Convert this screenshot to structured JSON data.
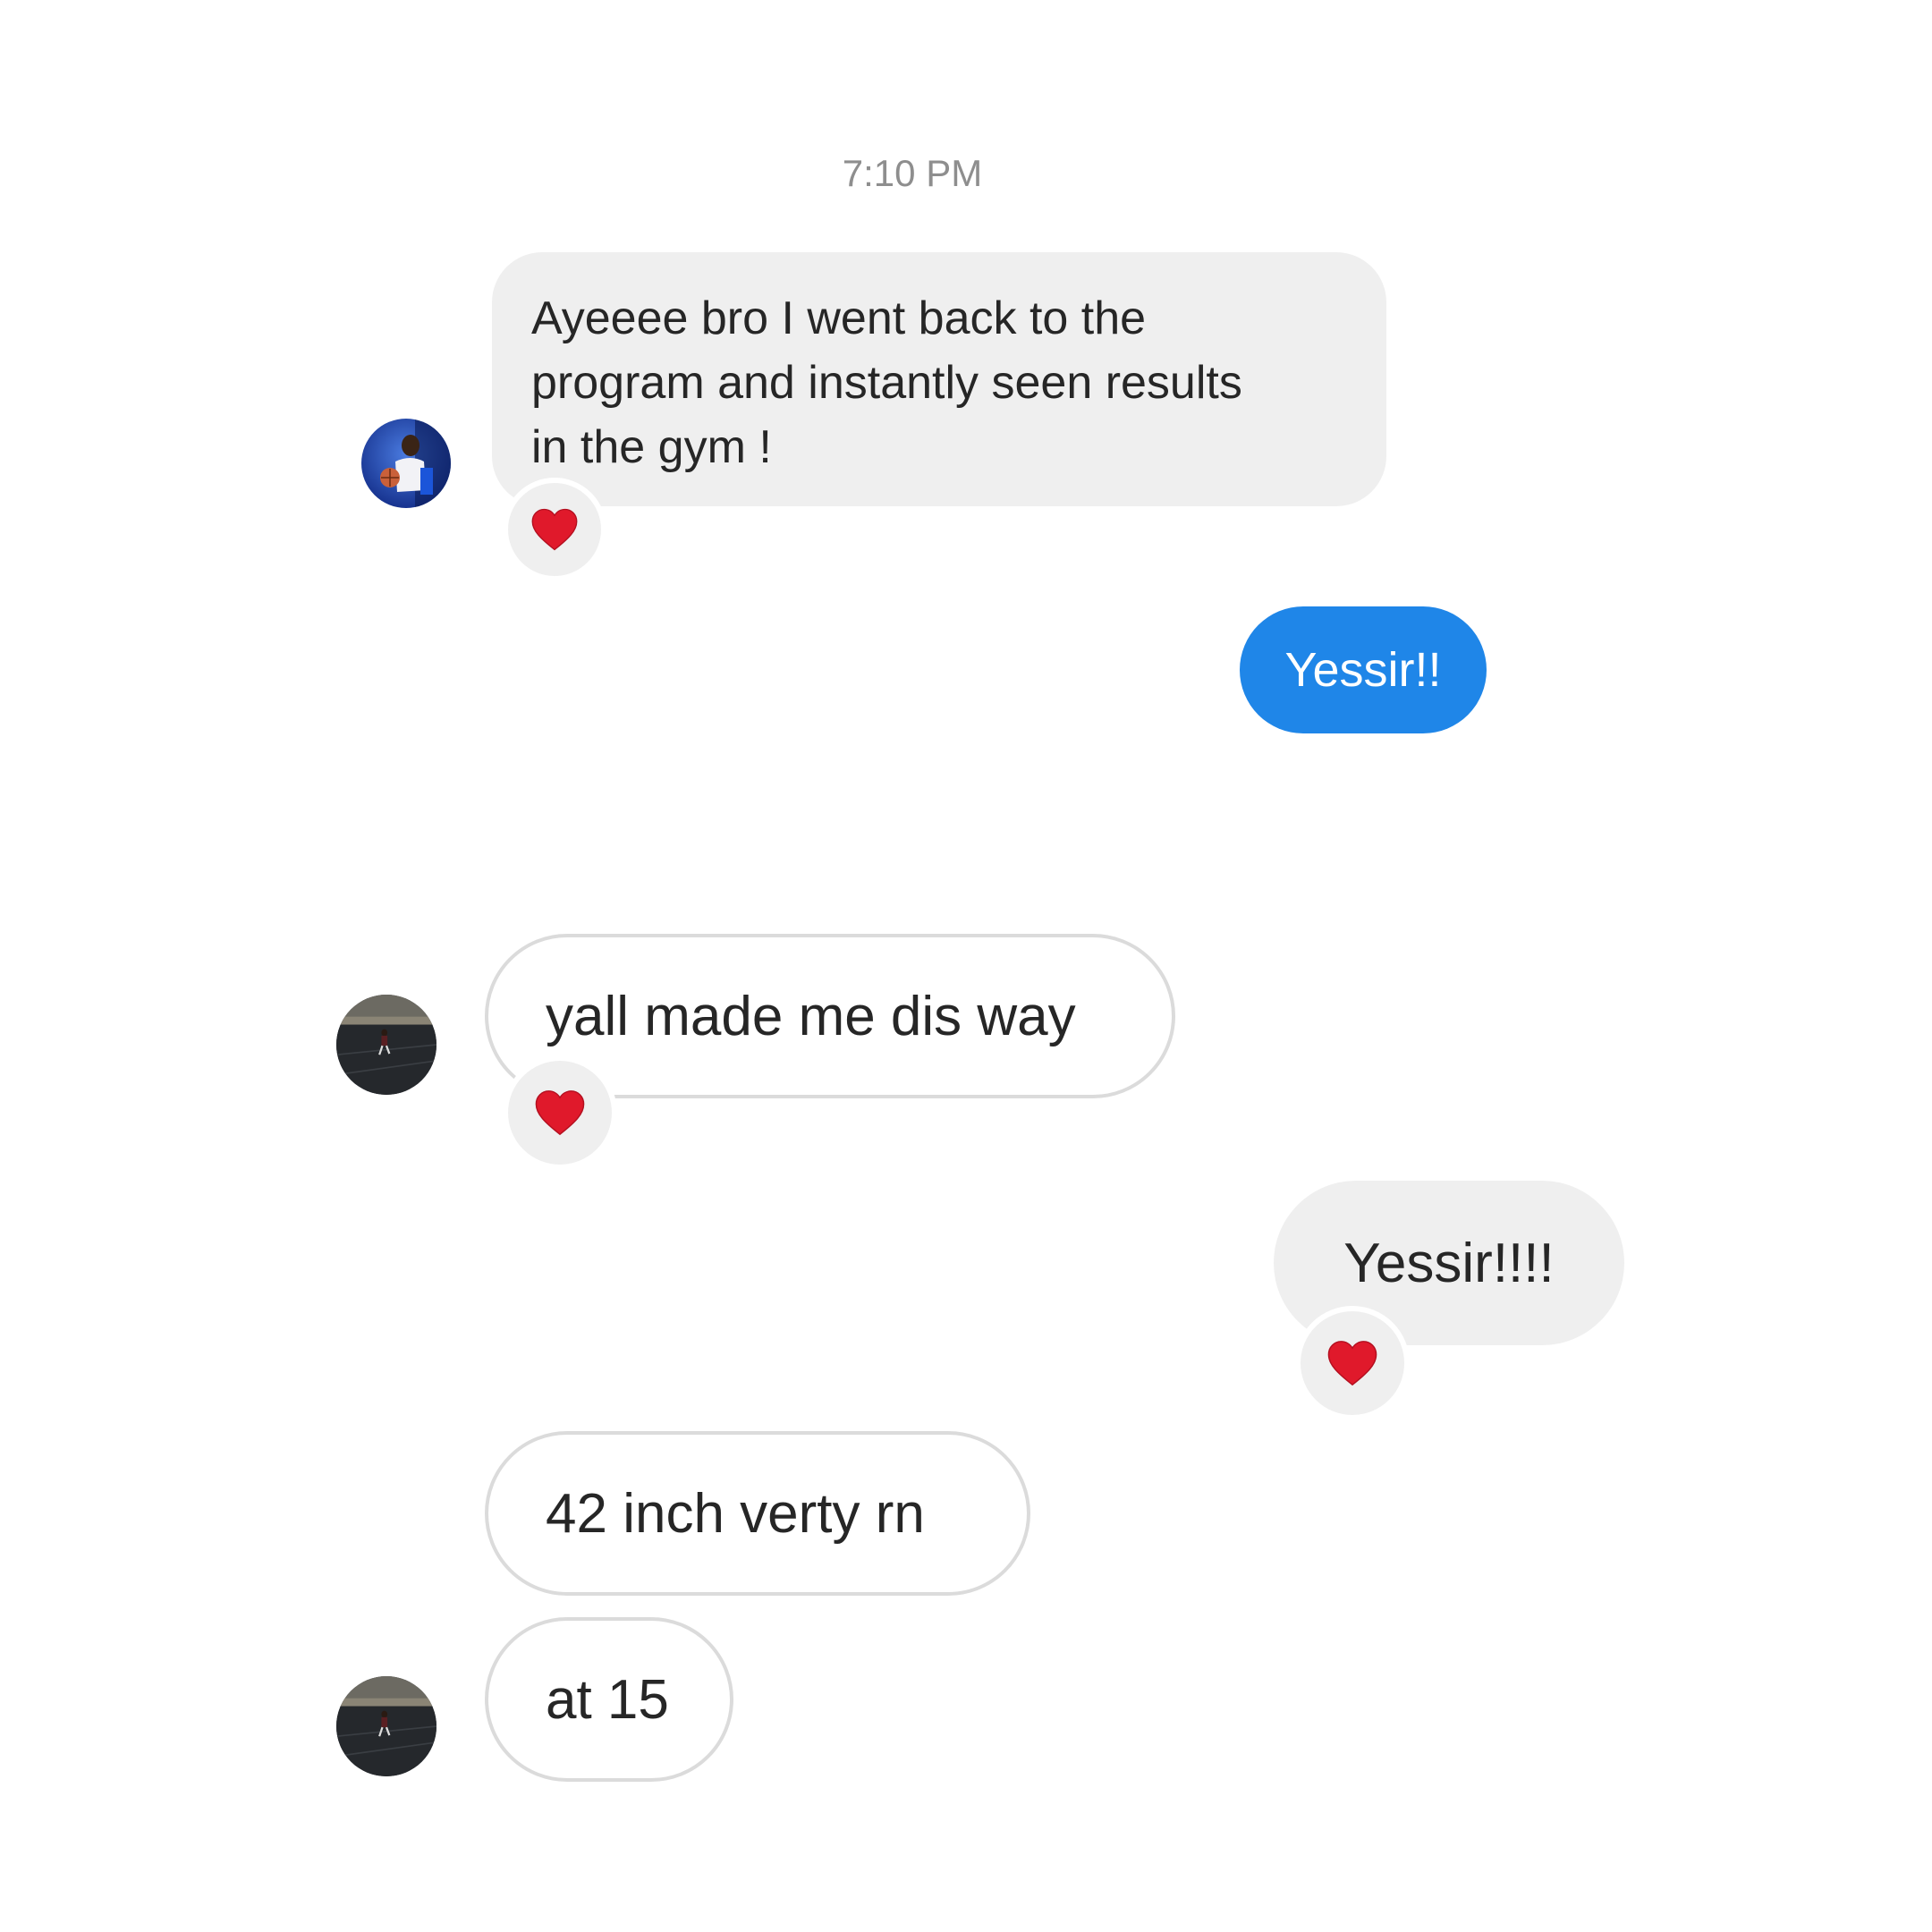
{
  "thread": {
    "timestamp": "7:10 PM",
    "messages": [
      {
        "sender": "them",
        "text_lines": [
          "Ayeeee bro I went back to the",
          "program and instantly seen results",
          "in the gym !"
        ],
        "reaction": "red-heart",
        "avatar": "basketball-player-avatar"
      },
      {
        "sender": "me",
        "text": "Yessir!!"
      },
      {
        "sender": "them",
        "text": "yall made me dis way",
        "reaction": "red-heart",
        "avatar": "track-runner-avatar"
      },
      {
        "sender": "me",
        "text": "Yessir!!!!",
        "reaction": "red-heart"
      },
      {
        "sender": "them",
        "text": "42 inch verty rn"
      },
      {
        "sender": "them",
        "text": "at 15",
        "avatar": "track-runner-avatar"
      }
    ]
  },
  "colors": {
    "sent_bubble": "#1f86e8",
    "received_bubble": "#efefef",
    "outline": "#dbdbdb",
    "heart": "#e0192b",
    "timestamp": "#8e8e8e"
  }
}
